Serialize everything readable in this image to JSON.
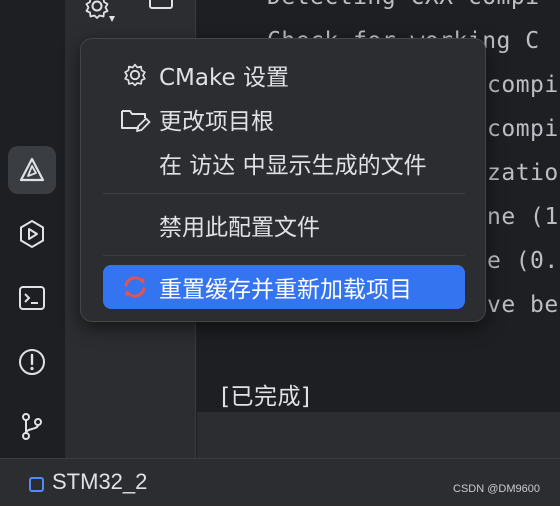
{
  "console": {
    "lines": [
      "Detecting CXX compi",
      "Check for working C",
      "compi",
      "compi",
      "zation",
      "ne (1",
      "e (0.",
      "ve be"
    ],
    "status": "[已完成]"
  },
  "menu": {
    "items": [
      {
        "label": "CMake 设置",
        "icon": "gear-icon"
      },
      {
        "label": "更改项目根",
        "icon": "folder-edit-icon"
      },
      {
        "label": "在 访达 中显示生成的文件",
        "icon": ""
      },
      {
        "label": "禁用此配置文件",
        "icon": ""
      },
      {
        "label": "重置缓存并重新加载项目",
        "icon": "reload-icon"
      }
    ]
  },
  "statusbar": {
    "project": "STM32_2",
    "watermark": "CSDN @DM9600"
  },
  "rail": {
    "icons": [
      "cmake-icon",
      "run-icon",
      "terminal-icon",
      "problems-icon",
      "git-icon"
    ]
  },
  "colors": {
    "accent": "#3574f0",
    "background": "#1e1f22",
    "panel": "#2b2d30",
    "reload_red": "#e5534b"
  }
}
